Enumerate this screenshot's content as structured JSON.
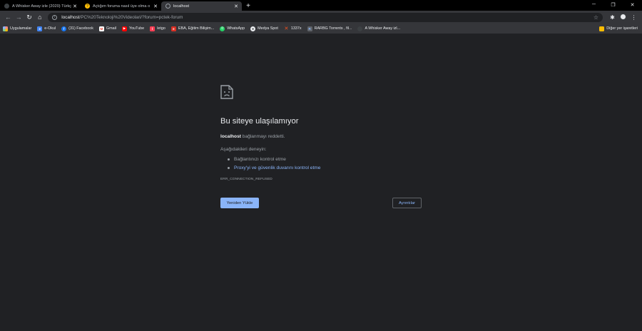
{
  "tabs": [
    {
      "title": "A Whisker Away izle (2020) Türkç",
      "favicon": "dark-circle-icon",
      "active": false
    },
    {
      "title": "Açtığım foruma nasıl üye olma o",
      "favicon": "forum-icon",
      "active": false
    },
    {
      "title": "localhost",
      "favicon": "globe-icon",
      "active": true
    }
  ],
  "toolbar": {
    "url_host": "localhost",
    "url_path": "/PC%20Teknoloji%20Videolari/?forum=pctek-forum"
  },
  "bookmarks": {
    "items": [
      {
        "label": "Uygulamalar",
        "icon": "apps-grid-icon",
        "color": "#f28b82"
      },
      {
        "label": "e-Okul",
        "icon": "e-okul-icon",
        "color": "#4285f4"
      },
      {
        "label": "(31) Facebook",
        "icon": "facebook-icon",
        "color": "#1877f2"
      },
      {
        "label": "Gmail",
        "icon": "gmail-icon",
        "color": "#ea4335"
      },
      {
        "label": "YouTube",
        "icon": "youtube-icon",
        "color": "#ff0000"
      },
      {
        "label": "letgo",
        "icon": "letgo-icon",
        "color": "#ff3f55"
      },
      {
        "label": "EBA, Eğitim Bilişim...",
        "icon": "eba-icon",
        "color": "#d93025"
      },
      {
        "label": "WhatsApp",
        "icon": "whatsapp-icon",
        "color": "#25d366"
      },
      {
        "label": "Medya Spot",
        "icon": "medya-spot-icon",
        "color": "#e8eaed"
      },
      {
        "label": "1337x",
        "icon": "1337x-icon",
        "color": "#f4511e"
      },
      {
        "label": "RARBG Torrents , fil...",
        "icon": "rarbg-icon",
        "color": "#8ab4f8"
      },
      {
        "label": "A Whisker Away izl...",
        "icon": "dark-circle-icon",
        "color": "#3c4043"
      }
    ],
    "other_label": "Diğer yer işaretleri"
  },
  "error": {
    "title": "Bu siteye ulaşılamıyor",
    "host": "localhost",
    "summary_rest": " bağlanmayı reddetti.",
    "try_label": "Aşağıdakileri deneyin:",
    "suggestions": [
      {
        "text": "Bağlantınızı kontrol etme",
        "is_link": false
      },
      {
        "text": "Proxy'yi ve güvenlik duvarını kontrol etme",
        "is_link": true
      }
    ],
    "code": "ERR_CONNECTION_REFUSED",
    "reload_label": "Yeniden Yükle",
    "details_label": "Ayrıntılar"
  },
  "colors": {
    "background": "#202124",
    "link": "#8ab4f8",
    "toolbar": "#35363a"
  }
}
